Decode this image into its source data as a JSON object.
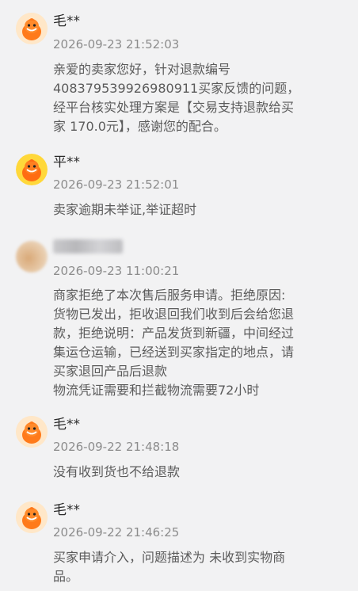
{
  "messages": [
    {
      "name": "毛**",
      "time": "2026-09-23 21:52:03",
      "text": "亲爱的卖家您好，针对退款编号\n408379539926980911买家反馈的问题，\n经平台核实处理方案是【交易支持退款给买\n家 170.0元】，感谢您的配合。"
    },
    {
      "name": "平**",
      "time": "2026-09-23 21:52:01",
      "text": "卖家逾期未举证,举证超时"
    },
    {
      "name": "",
      "time": "2026-09-23 11:00:21",
      "text": "商家拒绝了本次售后服务申请。拒绝原因:\n货物已发出，拒收退回我们收到后会给您退\n款，拒绝说明：产品发货到新疆，中间经过\n集运仓运输，已经送到买家指定的地点，请\n买家退回产品后退款\n物流凭证需要和拦截物流需要72小时"
    },
    {
      "name": "毛**",
      "time": "2026-09-22 21:48:18",
      "text": "没有收到货也不给退款"
    },
    {
      "name": "毛**",
      "time": "2026-09-22 21:46:25",
      "text": "买家申请介入，问题描述为 未收到实物商\n品。"
    }
  ]
}
